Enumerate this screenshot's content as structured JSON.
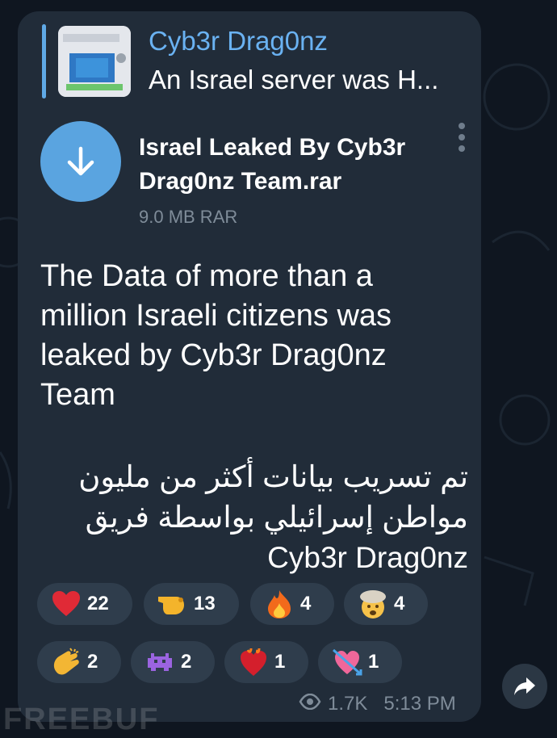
{
  "reply": {
    "name": "Cyb3r Drag0nz",
    "text": "An Israel server was H..."
  },
  "document": {
    "name": "Israel Leaked By Cyb3r Drag0nz Team.rar",
    "meta": "9.0 MB RAR",
    "icon": "download-arrow-icon"
  },
  "message": {
    "english": "The Data of more than a million Israeli citizens was leaked by Cyb3r Drag0nz Team",
    "arabic_lines": [
      "تم تسريب بيانات أكثر من مليون",
      "مواطن إسرائيلي بواسطة فريق",
      "Cyb3r Drag0nz"
    ]
  },
  "reactions": [
    {
      "icon": "red-heart-icon",
      "count": "22"
    },
    {
      "icon": "pointing-hand-icon",
      "count": "13"
    },
    {
      "icon": "fire-icon",
      "count": "4"
    },
    {
      "icon": "exploding-head-icon",
      "count": "4"
    },
    {
      "icon": "clapping-hands-icon",
      "count": "2"
    },
    {
      "icon": "space-invader-icon",
      "count": "2"
    },
    {
      "icon": "heart-on-fire-icon",
      "count": "1"
    },
    {
      "icon": "heart-with-arrow-icon",
      "count": "1"
    }
  ],
  "footer": {
    "views": "1.7K",
    "time": "5:13 PM"
  },
  "watermark": "FREEBUF",
  "colors": {
    "background": "#0f1620",
    "bubble": "#212c39",
    "accent": "#6ab2f2",
    "reaction_bg": "#2f3d4c"
  }
}
